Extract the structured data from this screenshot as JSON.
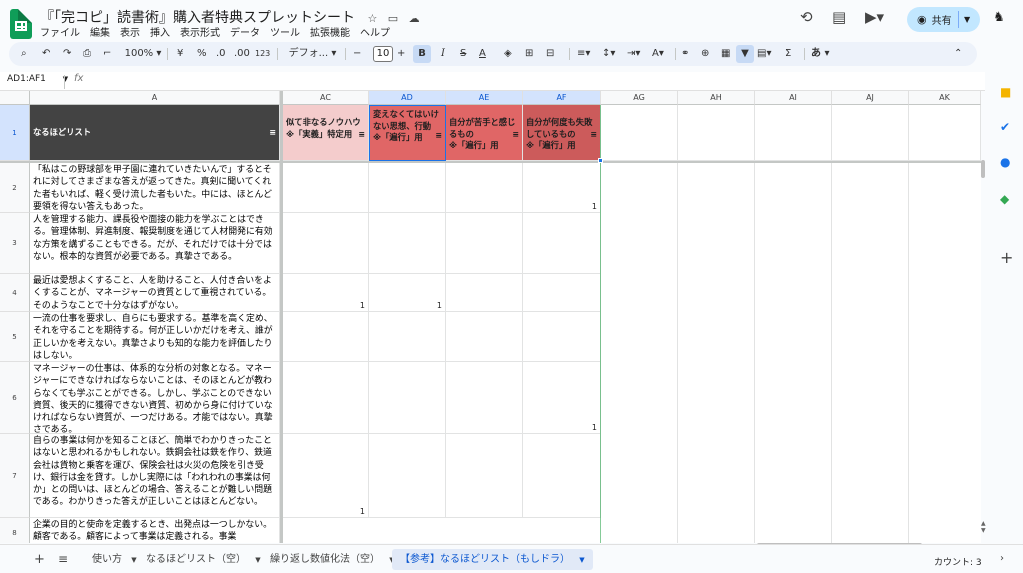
{
  "app": {
    "title": "『「完コピ」読書術』購入者特典スプレットシート",
    "menu": [
      "ファイル",
      "編集",
      "表示",
      "挿入",
      "表示形式",
      "データ",
      "ツール",
      "拡張機能",
      "ヘルプ"
    ],
    "share_label": "共有"
  },
  "toolbar": {
    "zoom": "100%",
    "currency": "¥",
    "percent": "%",
    "dec_decrease": ".0",
    "dec_increase": ".00",
    "number_format": "123",
    "font": "デフォ...",
    "font_size": "10",
    "bold": "B",
    "italic": "I",
    "strike": "S",
    "text_color": "A",
    "input_tools": "あ"
  },
  "formula_bar": {
    "name_box": "AD1:AF1",
    "fx": "fx"
  },
  "columns": [
    {
      "id": "A",
      "label": "A"
    },
    {
      "id": "AC",
      "label": "AC"
    },
    {
      "id": "AD",
      "label": "AD"
    },
    {
      "id": "AE",
      "label": "AE"
    },
    {
      "id": "AF",
      "label": "AF"
    },
    {
      "id": "AG",
      "label": "AG"
    },
    {
      "id": "AH",
      "label": "AH"
    },
    {
      "id": "AI",
      "label": "AI"
    },
    {
      "id": "AJ",
      "label": "AJ"
    },
    {
      "id": "AK",
      "label": "AK"
    }
  ],
  "headers": {
    "A": "なるほどリスト",
    "AC": "似て非なるノウハウ\n※「実義」特定用",
    "AD": "変えなくてはいけない思想、行動\n※「遍行」用",
    "AE": "自分が苦手と感じるもの\n※「遍行」用",
    "AF": "自分が何度も失敗しているもの\n※「遍行」用"
  },
  "rows": [
    {
      "num": "1"
    },
    {
      "num": "2",
      "text": "「私はこの野球部を甲子園に連れていきたいんで」するとそれに対してさまざまな答えが返ってきた。真剣に聞いてくれた者もいれば、軽く受け流した者もいた。中には、ほとんど要領を得ない答えもあった。",
      "AF": "1"
    },
    {
      "num": "3",
      "text": "人を管理する能力、課長役や面接の能力を学ぶことはできる。管理体制、昇進制度、報奨制度を通じて人材開発に有効な方策を講ずることもできる。だが、それだけでは十分ではない。根本的な資質が必要である。真摯さである。"
    },
    {
      "num": "4",
      "text": "最近は愛想よくすること、人を助けること、人付き合いをよくすることが、マネージャーの資質として重視されている。そのようなことで十分なはずがない。",
      "AC": "1",
      "AD": "1"
    },
    {
      "num": "5",
      "text": "一流の仕事を要求し、自らにも要求する。基準を高く定め、それを守ることを期待する。何が正しいかだけを考え、誰が正しいかを考えない。真摯さよりも知的な能力を評価したりはしない。"
    },
    {
      "num": "6",
      "text": "マネージャーの仕事は、体系的な分析の対象となる。マネージャーにできなければならないことは、そのほとんどが教わらなくても学ぶことができる。しかし、学ぶことのできない資質、後天的に獲得できない資質、初めから身に付けていなければならない資質が、一つだけある。才能ではない。真摯さである。",
      "AF": "1"
    },
    {
      "num": "7",
      "text": "自らの事業は何かを知ることほど、簡単でわかりきったことはないと思われるかもしれない。鉄鋼会社は鉄を作り、鉄道会社は貨物と乗客を運び、保険会社は火災の危険を引き受け、銀行は金を貸す。しかし実際には「われわれの事業は何か」との問いは、ほとんどの場合、答えることが難しい問題である。わかりきった答えが正しいことはほとんどない。",
      "AC": "1"
    },
    {
      "num": "8",
      "text": "企業の目的と使命を定義するとき、出発点は一つしかない。顧客である。顧客によって事業は定義される。事業"
    }
  ],
  "tabs": {
    "items": [
      "使い方",
      "なるほどリスト（空）",
      "繰り返し数値化法（空）",
      "【参考】なるほどリスト（もしドラ）"
    ],
    "active": 3
  },
  "status": {
    "count": "カウント: 3"
  },
  "colors": {
    "header_dark": "#434343",
    "header_pink": "#f4cccc",
    "header_red": "#e06666",
    "header_deep": "#cc4125",
    "accent": "#0b57d0",
    "selection": "#d3e3fd"
  },
  "icons": [
    "star-icon",
    "folder-move-icon",
    "cloud-status-icon",
    "history-icon",
    "comment-icon",
    "meet-icon",
    "globe-icon",
    "search-icon",
    "undo-icon",
    "redo-icon",
    "print-icon",
    "paint-format-icon",
    "filter-icon"
  ]
}
